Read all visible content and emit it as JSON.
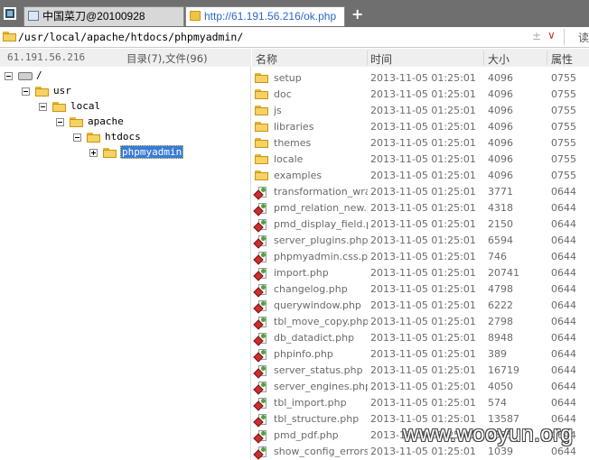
{
  "tabs": [
    {
      "label": "中国菜刀@20100928",
      "active": false
    },
    {
      "label": "http://61.191.56.216/ok.php",
      "active": true
    }
  ],
  "new_tab_label": "+",
  "path": "/usr/local/apache/htdocs/phpmyadmin/",
  "path_plusminus": "±",
  "path_dropdown": "∨",
  "read_button": "读",
  "left_header": {
    "host": "61.191.56.216",
    "counts": "目录(7),文件(96)"
  },
  "tree": [
    {
      "label": "/",
      "selected": false
    },
    {
      "label": "usr",
      "selected": false
    },
    {
      "label": "local",
      "selected": false
    },
    {
      "label": "apache",
      "selected": false
    },
    {
      "label": "htdocs",
      "selected": false
    },
    {
      "label": "phpmyadmin",
      "selected": true
    }
  ],
  "columns": {
    "name": "名称",
    "time": "时间",
    "size": "大小",
    "attr": "属性"
  },
  "files": [
    {
      "type": "folder",
      "name": "setup",
      "time": "2013-11-05 01:25:01",
      "size": "4096",
      "attr": "0755"
    },
    {
      "type": "folder",
      "name": "doc",
      "time": "2013-11-05 01:25:01",
      "size": "4096",
      "attr": "0755"
    },
    {
      "type": "folder",
      "name": "js",
      "time": "2013-11-05 01:25:01",
      "size": "4096",
      "attr": "0755"
    },
    {
      "type": "folder",
      "name": "libraries",
      "time": "2013-11-05 01:25:01",
      "size": "4096",
      "attr": "0755"
    },
    {
      "type": "folder",
      "name": "themes",
      "time": "2013-11-05 01:25:01",
      "size": "4096",
      "attr": "0755"
    },
    {
      "type": "folder",
      "name": "locale",
      "time": "2013-11-05 01:25:01",
      "size": "4096",
      "attr": "0755"
    },
    {
      "type": "folder",
      "name": "examples",
      "time": "2013-11-05 01:25:01",
      "size": "4096",
      "attr": "0755"
    },
    {
      "type": "file",
      "name": "transformation_wrap...",
      "time": "2013-11-05 01:25:01",
      "size": "3771",
      "attr": "0644"
    },
    {
      "type": "file",
      "name": "pmd_relation_new.p...",
      "time": "2013-11-05 01:25:01",
      "size": "4318",
      "attr": "0644"
    },
    {
      "type": "file",
      "name": "pmd_display_field.php",
      "time": "2013-11-05 01:25:01",
      "size": "2150",
      "attr": "0644"
    },
    {
      "type": "file",
      "name": "server_plugins.php",
      "time": "2013-11-05 01:25:01",
      "size": "6594",
      "attr": "0644"
    },
    {
      "type": "file",
      "name": "phpmyadmin.css.php",
      "time": "2013-11-05 01:25:01",
      "size": "746",
      "attr": "0644"
    },
    {
      "type": "file",
      "name": "import.php",
      "time": "2013-11-05 01:25:01",
      "size": "20741",
      "attr": "0644"
    },
    {
      "type": "file",
      "name": "changelog.php",
      "time": "2013-11-05 01:25:01",
      "size": "4798",
      "attr": "0644"
    },
    {
      "type": "file",
      "name": "querywindow.php",
      "time": "2013-11-05 01:25:01",
      "size": "6222",
      "attr": "0644"
    },
    {
      "type": "file",
      "name": "tbl_move_copy.php",
      "time": "2013-11-05 01:25:01",
      "size": "2798",
      "attr": "0644"
    },
    {
      "type": "file",
      "name": "db_datadict.php",
      "time": "2013-11-05 01:25:01",
      "size": "8948",
      "attr": "0644"
    },
    {
      "type": "file",
      "name": "phpinfo.php",
      "time": "2013-11-05 01:25:01",
      "size": "389",
      "attr": "0644"
    },
    {
      "type": "file",
      "name": "server_status.php",
      "time": "2013-11-05 01:25:01",
      "size": "16719",
      "attr": "0644"
    },
    {
      "type": "file",
      "name": "server_engines.php",
      "time": "2013-11-05 01:25:01",
      "size": "4050",
      "attr": "0644"
    },
    {
      "type": "file",
      "name": "tbl_import.php",
      "time": "2013-11-05 01:25:01",
      "size": "574",
      "attr": "0644"
    },
    {
      "type": "file",
      "name": "tbl_structure.php",
      "time": "2013-11-05 01:25:01",
      "size": "13587",
      "attr": "0644"
    },
    {
      "type": "file",
      "name": "pmd_pdf.php",
      "time": "2013-11-05 01:25:01",
      "size": "2535",
      "attr": "0644"
    },
    {
      "type": "file",
      "name": "show_config_errors....",
      "time": "2013-11-05 01:25:01",
      "size": "1039",
      "attr": "0644"
    }
  ],
  "watermark": "www.wooyun.org"
}
